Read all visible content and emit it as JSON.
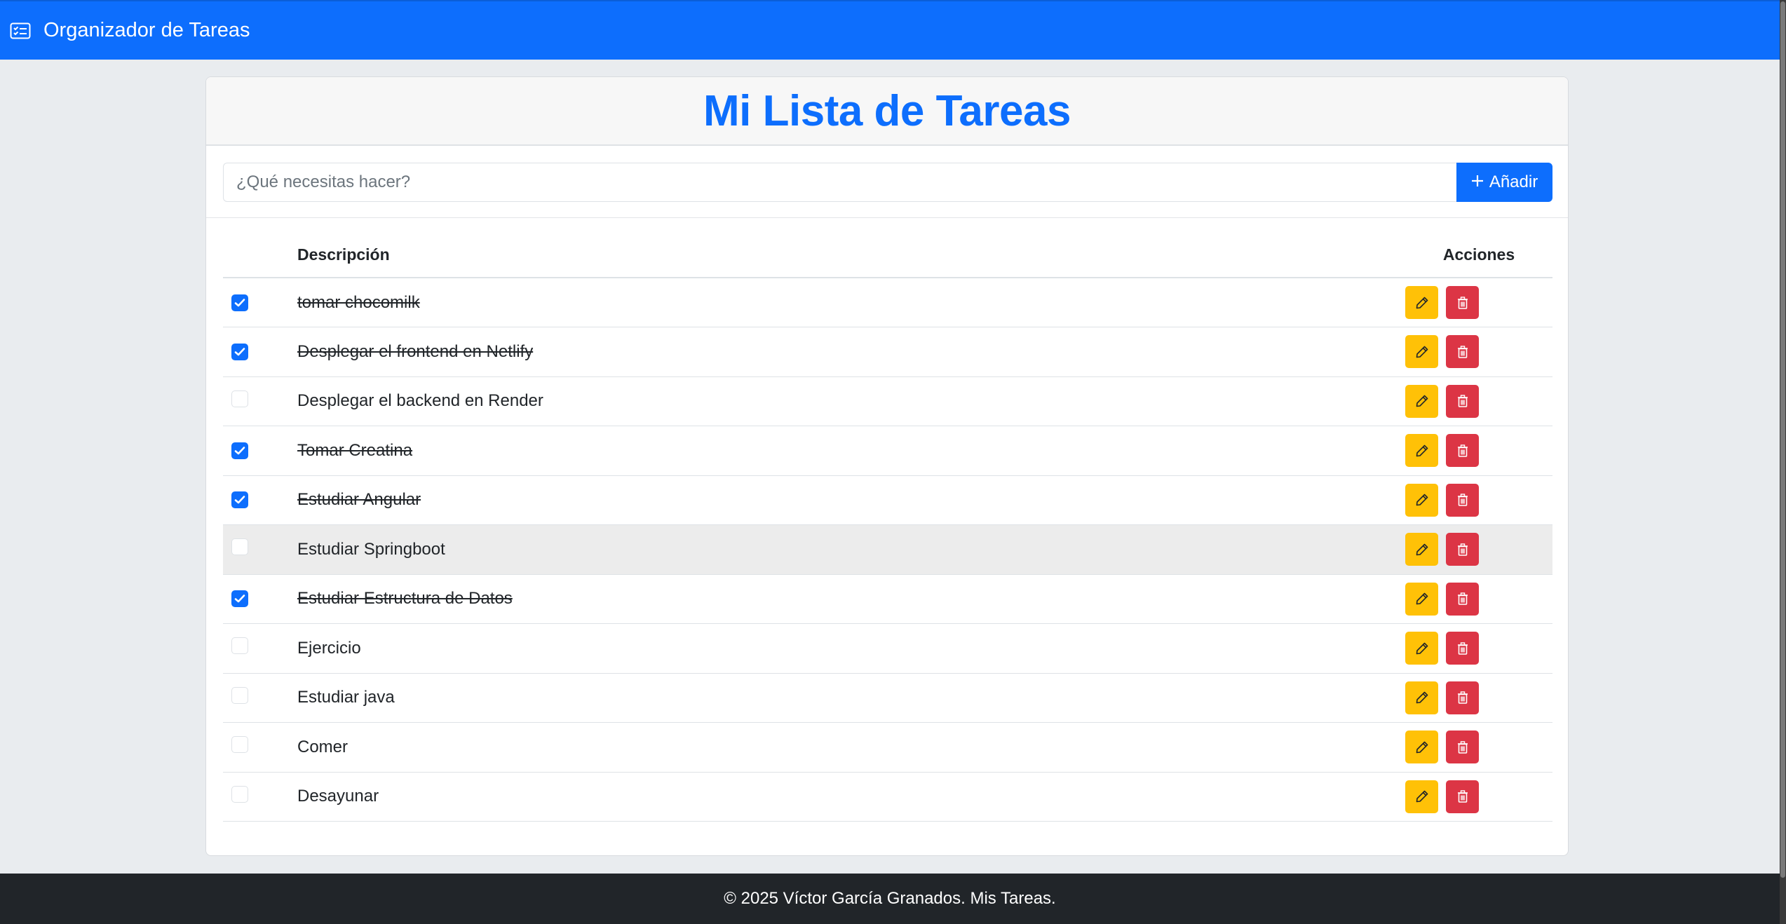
{
  "navbar": {
    "brand": "Organizador de Tareas",
    "icon": "card-checklist-icon"
  },
  "card": {
    "title": "Mi Lista de Tareas"
  },
  "new_task": {
    "placeholder": "¿Qué necesitas hacer?",
    "add_label": "Añadir"
  },
  "table": {
    "headers": {
      "description": "Descripción",
      "actions": "Acciones"
    },
    "rows": [
      {
        "text": "tomar chocomilk",
        "done": true
      },
      {
        "text": "Desplegar el frontend en Netlify",
        "done": true
      },
      {
        "text": "Desplegar el backend en Render",
        "done": false
      },
      {
        "text": "Tomar Creatina",
        "done": true
      },
      {
        "text": "Estudiar Angular",
        "done": true
      },
      {
        "text": "Estudiar Springboot",
        "done": false
      },
      {
        "text": "Estudiar Estructura de Datos",
        "done": true
      },
      {
        "text": "Ejercicio",
        "done": false
      },
      {
        "text": "Estudiar java",
        "done": false
      },
      {
        "text": "Comer",
        "done": false
      },
      {
        "text": "Desayunar",
        "done": false
      }
    ]
  },
  "footer": {
    "text": "© 2025 Víctor García Granados. Mis Tareas."
  },
  "colors": {
    "primary": "#0d6efd",
    "edit": "#ffc107",
    "delete": "#dc3545",
    "footer": "#212529"
  }
}
